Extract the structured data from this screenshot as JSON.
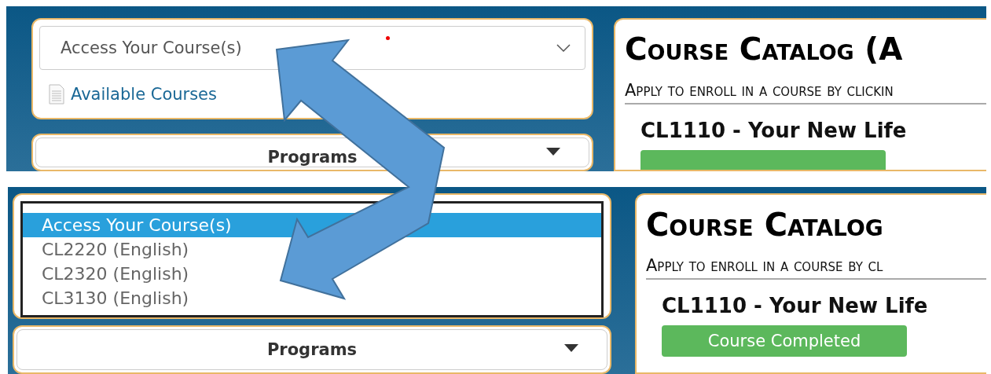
{
  "screens": [
    {
      "kind": "closed",
      "select": {
        "value": "Access Your Course(s)",
        "required": true
      },
      "link": "Available Courses",
      "programs": "Programs",
      "catalog": {
        "title": "Course Catalog (A",
        "subtitle": "Apply to enroll in a course by clickin",
        "course": "CL1110 - Your New Life"
      }
    },
    {
      "kind": "open",
      "options": [
        {
          "label": "Access Your Course(s)",
          "selected": true
        },
        {
          "label": "CL2220 (English)",
          "selected": false
        },
        {
          "label": "CL2320 (English)",
          "selected": false
        },
        {
          "label": "CL3130 (English)",
          "selected": false
        }
      ],
      "programs": "Programs",
      "catalog": {
        "title": "Course Catalog",
        "subtitle": "Apply to enroll in a course by cl",
        "course": "CL1110 - Your New Life",
        "button": "Course Completed"
      }
    }
  ]
}
